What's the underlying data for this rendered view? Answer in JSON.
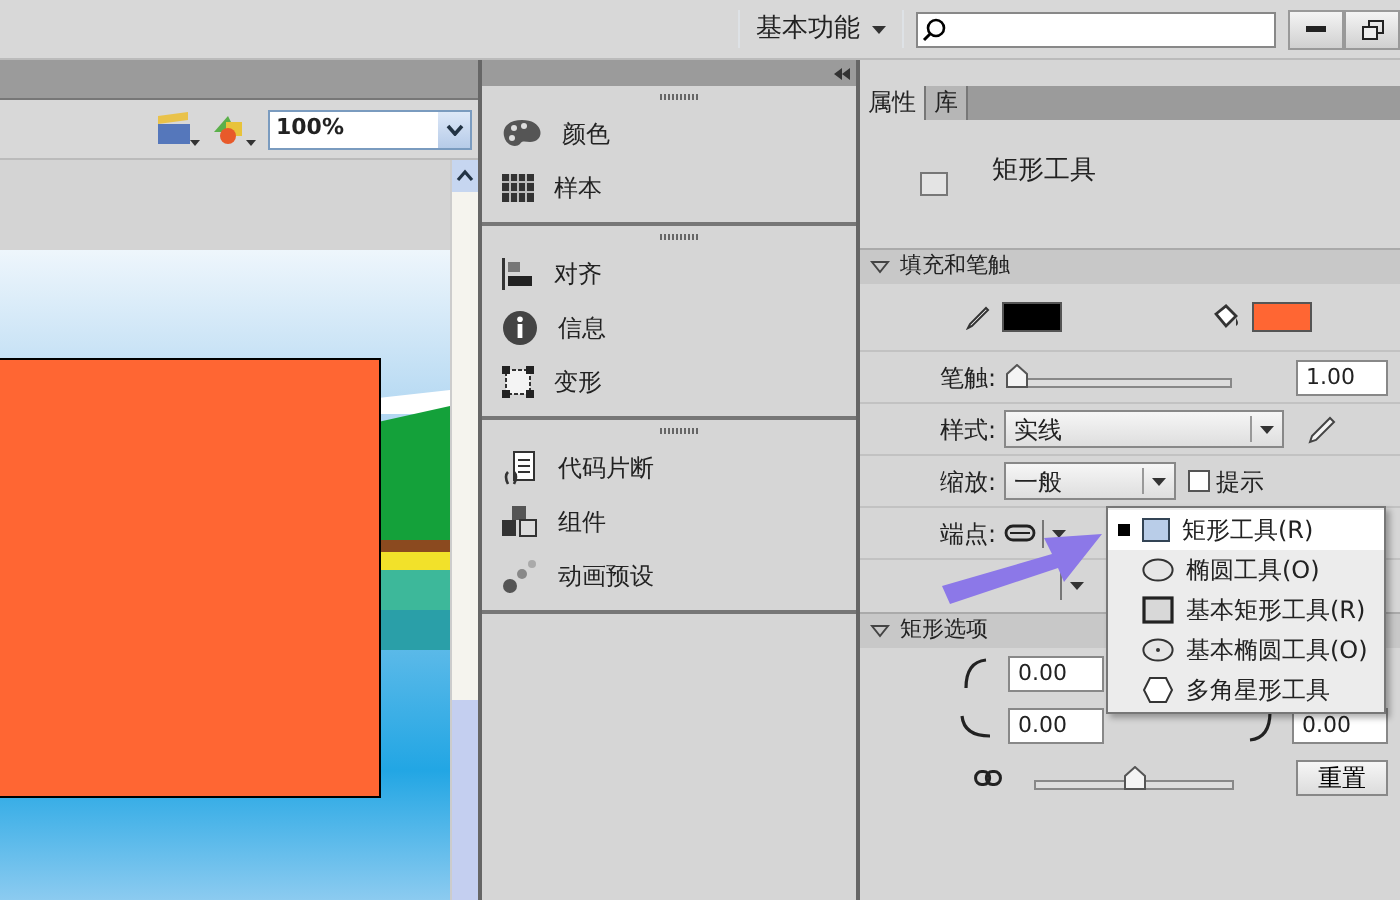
{
  "top_bar": {
    "workspace": "基本功能"
  },
  "stage_panel": {
    "zoom": "100%"
  },
  "tool_panels": [
    [
      {
        "label": "颜色"
      },
      {
        "label": "样本"
      }
    ],
    [
      {
        "label": "对齐"
      },
      {
        "label": "信息"
      },
      {
        "label": "变形"
      }
    ],
    [
      {
        "label": "代码片断"
      },
      {
        "label": "组件"
      },
      {
        "label": "动画预设"
      }
    ]
  ],
  "properties": {
    "tabs": [
      {
        "label": "属性",
        "selected": true
      },
      {
        "label": "库",
        "selected": false
      }
    ],
    "tool_name": "矩形工具",
    "fill_stroke": {
      "title": "填充和笔触",
      "expanded": true,
      "swatches": [
        {
          "color": "#000000"
        },
        {
          "color": "#ff6633"
        }
      ],
      "stroke_label": "笔触:",
      "stroke": {
        "level": 0
      },
      "stroke_value": "1.00",
      "style_label": "样式:",
      "style_value": "实线",
      "scale_label": "缩放:",
      "scale_value": "一般",
      "hint": {
        "label": "提示",
        "checked": false
      },
      "cap_label": "端点:"
    },
    "rect_options": {
      "title": "矩形选项",
      "expanded": true,
      "corners": [
        "0.00",
        "0.00",
        "0.00"
      ],
      "radius": {
        "level": 0.5
      },
      "reset": "重置"
    }
  },
  "tool_menu": [
    {
      "label": "矩形工具(R)",
      "selected": true
    },
    {
      "label": "椭圆工具(O)",
      "selected": false
    },
    {
      "label": "基本矩形工具(R)",
      "selected": false
    },
    {
      "label": "基本椭圆工具(O)",
      "selected": false
    },
    {
      "label": "多角星形工具",
      "selected": false
    }
  ]
}
